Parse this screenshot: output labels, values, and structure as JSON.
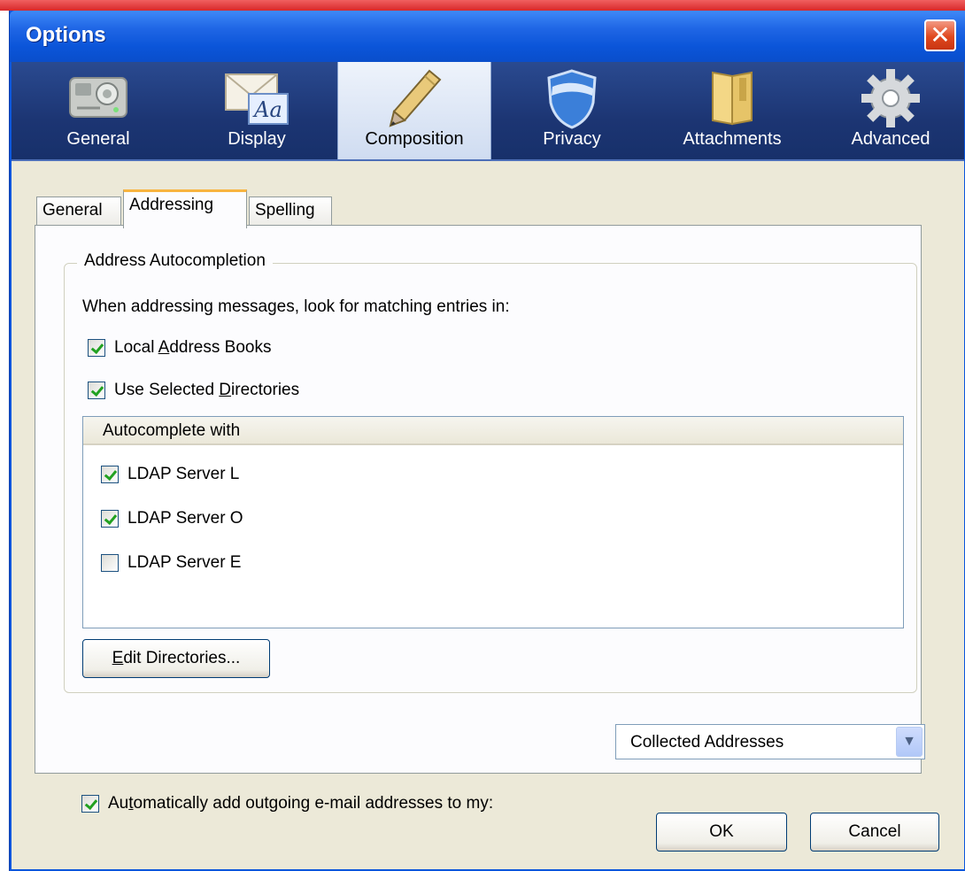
{
  "window": {
    "title": "Options",
    "close_glyph": "✕"
  },
  "prefpanes": [
    {
      "label": "General",
      "icon": "general-switch-icon"
    },
    {
      "label": "Display",
      "icon": "display-letter-icon"
    },
    {
      "label": "Composition",
      "icon": "pencil-icon",
      "selected": true
    },
    {
      "label": "Privacy",
      "icon": "shield-icon"
    },
    {
      "label": "Attachments",
      "icon": "folder-icon"
    },
    {
      "label": "Advanced",
      "icon": "gear-icon"
    }
  ],
  "tabs": [
    {
      "label": "General"
    },
    {
      "label": "Addressing",
      "active": true
    },
    {
      "label": "Spelling"
    }
  ],
  "autocompletion": {
    "caption": "Address Autocompletion",
    "description": "When addressing messages, look for matching entries in:",
    "local_address_books": {
      "pre": "Local ",
      "accesskey": "A",
      "post": "ddress Books",
      "checked": true
    },
    "use_selected_directories": {
      "pre": "Use Selected ",
      "accesskey": "D",
      "post": "irectories",
      "checked": true
    },
    "list_header": "Autocomplete with",
    "servers": [
      {
        "label": "LDAP Server L",
        "checked": true
      },
      {
        "label": "LDAP Server O",
        "checked": true
      },
      {
        "label": "LDAP Server E",
        "checked": false
      }
    ],
    "edit_button": {
      "accesskey": "E",
      "post": "dit Directories..."
    }
  },
  "outgoing": {
    "pre": "Au",
    "accesskey": "t",
    "post": "omatically add outgoing e-mail addresses to my:",
    "checked": true,
    "selected_book": "Collected Addresses",
    "dropdown_glyph": "▼"
  },
  "buttons": {
    "ok": "OK",
    "cancel": "Cancel"
  },
  "colors": {
    "title_bar": "#0b55d9",
    "pref_bar": "#1c3573",
    "client": "#ece9d8",
    "tab_highlight": "#f8b440",
    "check": "#21a121"
  }
}
